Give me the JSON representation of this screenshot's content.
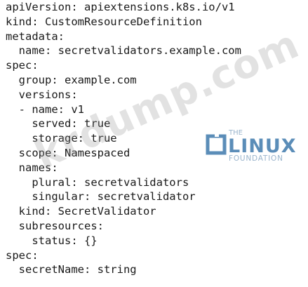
{
  "document": {
    "lines": [
      "apiVersion: apiextensions.k8s.io/v1",
      "kind: CustomResourceDefinition",
      "metadata:",
      "  name: secretvalidators.example.com",
      "spec:",
      "  group: example.com",
      "  versions:",
      "  - name: v1",
      "    served: true",
      "    storage: true",
      "  scope: Namespaced",
      "  names:",
      "    plural: secretvalidators",
      "    singular: secretvalidator",
      "  kind: SecretValidator",
      "  subresources:",
      "    status: {}",
      "spec:",
      "  secretName: string"
    ]
  },
  "watermark": {
    "text": "krdump.com"
  },
  "logo": {
    "line1": "THE",
    "line2": "LINUX",
    "line3": "FOUNDATION",
    "color": "#5b8db8"
  }
}
